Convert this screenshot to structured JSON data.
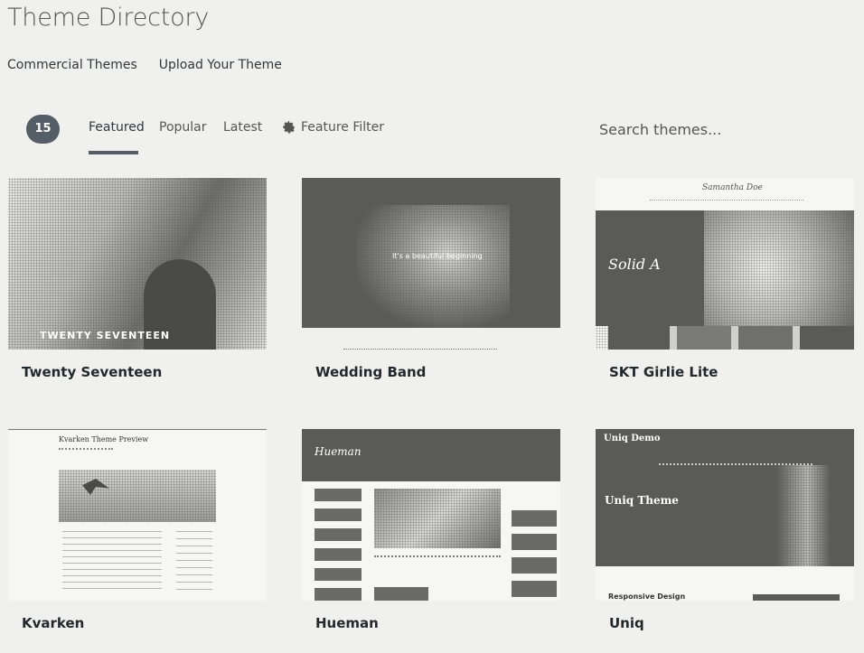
{
  "page": {
    "title": "Theme Directory",
    "subnav": [
      "Commercial Themes",
      "Upload Your Theme"
    ]
  },
  "filter": {
    "count": "15",
    "tabs": [
      "Featured",
      "Popular",
      "Latest"
    ],
    "feature_filter": "Feature Filter",
    "search_placeholder": "Search themes..."
  },
  "themes": [
    {
      "name": "Twenty Seventeen",
      "screenshot_text": "TWENTY SEVENTEEN"
    },
    {
      "name": "Wedding Band",
      "screenshot_text": "It's a beautiful beginning"
    },
    {
      "name": "SKT Girlie Lite",
      "screenshot_text": "Solid A",
      "screenshot_header": "Samantha Doe"
    },
    {
      "name": "Kvarken",
      "screenshot_text": "Kvarken Theme Preview"
    },
    {
      "name": "Hueman",
      "screenshot_text": "Hueman"
    },
    {
      "name": "Uniq",
      "screenshot_text": "Uniq Theme",
      "screenshot_header": "Uniq Demo",
      "screenshot_footer": "Responsive Design"
    }
  ]
}
